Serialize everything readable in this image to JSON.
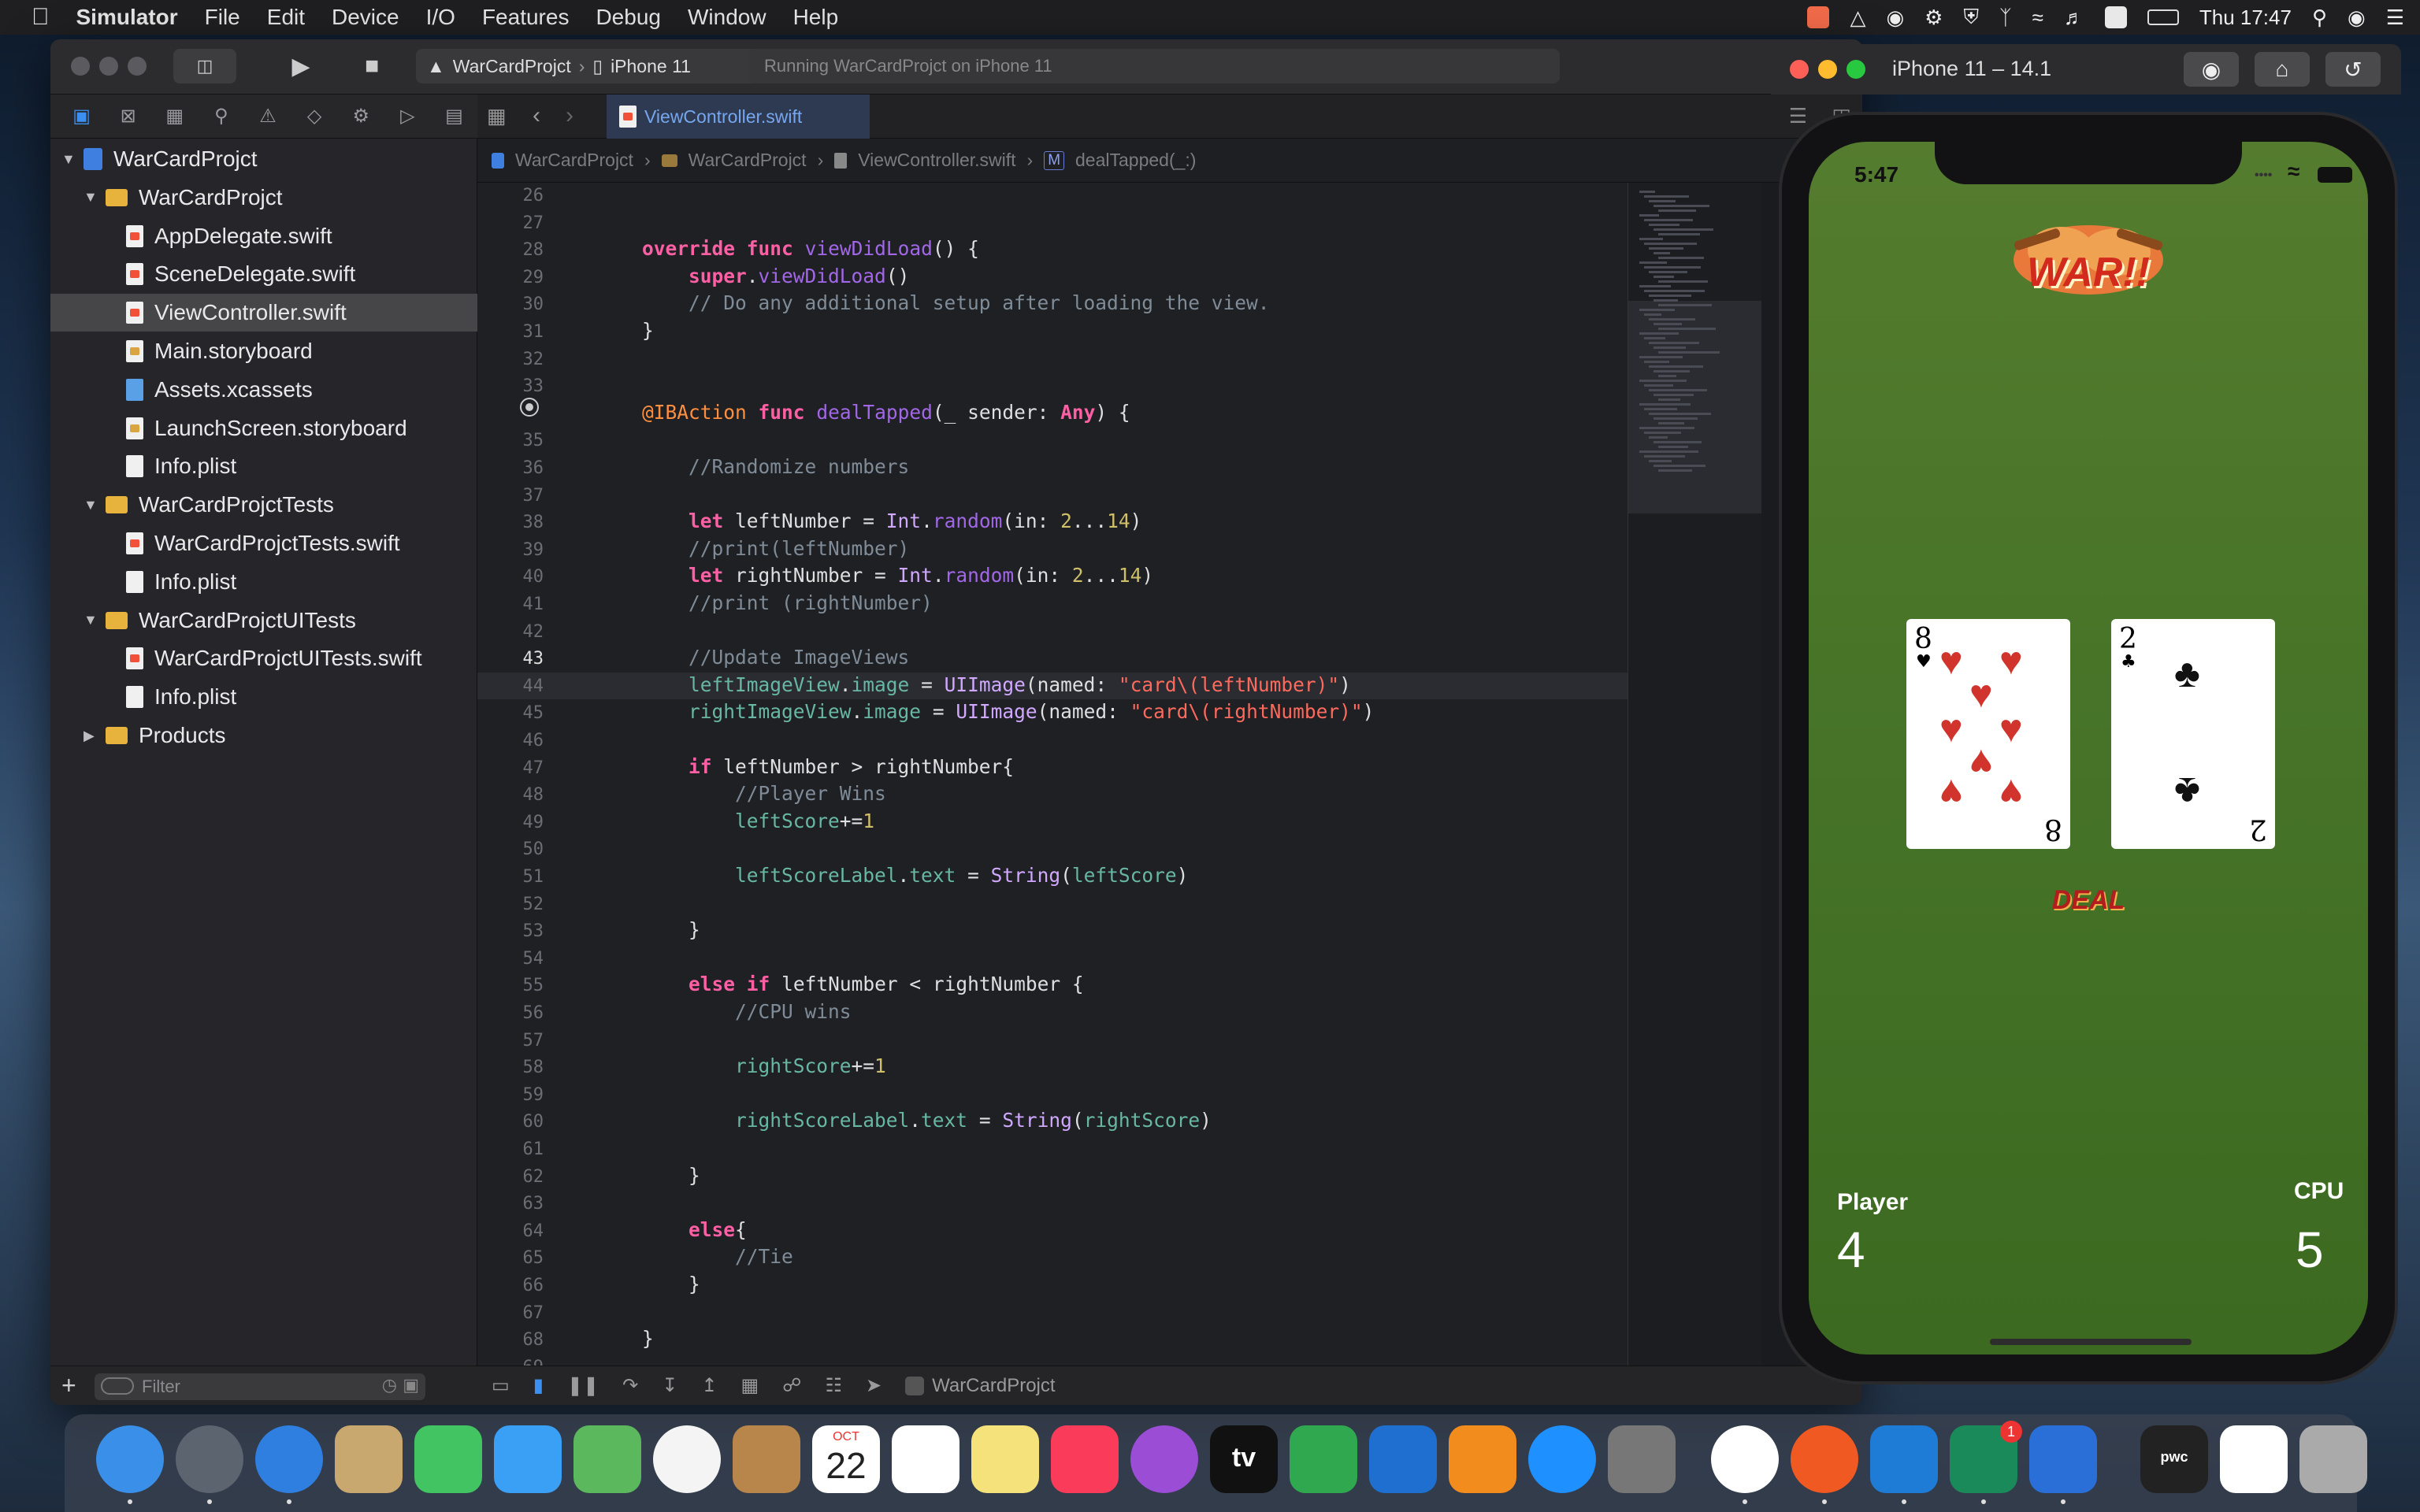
{
  "menubar": {
    "app": "Simulator",
    "items": [
      "File",
      "Edit",
      "Device",
      "I/O",
      "Features",
      "Debug",
      "Window",
      "Help"
    ],
    "clock": "Thu 17:47"
  },
  "toolbar": {
    "scheme": "WarCardProjct",
    "device": "iPhone 11",
    "status": "Running WarCardProjct on iPhone 11"
  },
  "tab": {
    "label": "ViewController.swift"
  },
  "jumpbar": {
    "path": [
      "WarCardProjct",
      "WarCardProjct",
      "ViewController.swift"
    ],
    "method_badge": "M",
    "method": "dealTapped(_:)"
  },
  "navigator": {
    "filter_placeholder": "Filter",
    "rows": [
      {
        "label": "WarCardProjct",
        "kind": "project",
        "indent": 0,
        "disclosure": "open"
      },
      {
        "label": "WarCardProjct",
        "kind": "folder",
        "indent": 1,
        "disclosure": "open"
      },
      {
        "label": "AppDelegate.swift",
        "kind": "swift",
        "indent": 2
      },
      {
        "label": "SceneDelegate.swift",
        "kind": "swift",
        "indent": 2
      },
      {
        "label": "ViewController.swift",
        "kind": "swift",
        "indent": 2,
        "selected": true
      },
      {
        "label": "Main.storyboard",
        "kind": "storyboard",
        "indent": 2
      },
      {
        "label": "Assets.xcassets",
        "kind": "assets",
        "indent": 2
      },
      {
        "label": "LaunchScreen.storyboard",
        "kind": "storyboard",
        "indent": 2
      },
      {
        "label": "Info.plist",
        "kind": "plist",
        "indent": 2
      },
      {
        "label": "WarCardProjctTests",
        "kind": "folder",
        "indent": 1,
        "disclosure": "open"
      },
      {
        "label": "WarCardProjctTests.swift",
        "kind": "swift",
        "indent": 2
      },
      {
        "label": "Info.plist",
        "kind": "plist",
        "indent": 2
      },
      {
        "label": "WarCardProjctUITests",
        "kind": "folder",
        "indent": 1,
        "disclosure": "open"
      },
      {
        "label": "WarCardProjctUITests.swift",
        "kind": "swift",
        "indent": 2
      },
      {
        "label": "Info.plist",
        "kind": "plist",
        "indent": 2
      },
      {
        "label": "Products",
        "kind": "folder",
        "indent": 1,
        "disclosure": "closed"
      }
    ]
  },
  "editor": {
    "current_line": 43,
    "lines": [
      {
        "n": "26",
        "t": ""
      },
      {
        "n": "27",
        "t": ""
      },
      {
        "n": "28",
        "t": "    override func viewDidLoad() {"
      },
      {
        "n": "29",
        "t": "        super.viewDidLoad()"
      },
      {
        "n": "30",
        "t": "        // Do any additional setup after loading the view."
      },
      {
        "n": "31",
        "t": "    }"
      },
      {
        "n": "32",
        "t": ""
      },
      {
        "n": "33",
        "t": ""
      },
      {
        "n": "",
        "t": "    @IBAction func dealTapped(_ sender: Any) {"
      },
      {
        "n": "35",
        "t": ""
      },
      {
        "n": "36",
        "t": "        //Randomize numbers"
      },
      {
        "n": "37",
        "t": ""
      },
      {
        "n": "38",
        "t": "        let leftNumber = Int.random(in: 2...14)"
      },
      {
        "n": "39",
        "t": "        //print(leftNumber)"
      },
      {
        "n": "40",
        "t": "        let rightNumber = Int.random(in: 2...14)"
      },
      {
        "n": "41",
        "t": "        //print (rightNumber)"
      },
      {
        "n": "42",
        "t": ""
      },
      {
        "n": "43",
        "t": "        //Update ImageViews"
      },
      {
        "n": "44",
        "t": "        leftImageView.image = UIImage(named: \"card\\(leftNumber)\")"
      },
      {
        "n": "45",
        "t": "        rightImageView.image = UIImage(named: \"card\\(rightNumber)\")"
      },
      {
        "n": "46",
        "t": ""
      },
      {
        "n": "47",
        "t": "        if leftNumber > rightNumber{"
      },
      {
        "n": "48",
        "t": "            //Player Wins"
      },
      {
        "n": "49",
        "t": "            leftScore+=1"
      },
      {
        "n": "50",
        "t": ""
      },
      {
        "n": "51",
        "t": "            leftScoreLabel.text = String(leftScore)"
      },
      {
        "n": "52",
        "t": ""
      },
      {
        "n": "53",
        "t": "        }"
      },
      {
        "n": "54",
        "t": ""
      },
      {
        "n": "55",
        "t": "        else if leftNumber < rightNumber {"
      },
      {
        "n": "56",
        "t": "            //CPU wins"
      },
      {
        "n": "57",
        "t": ""
      },
      {
        "n": "58",
        "t": "            rightScore+=1"
      },
      {
        "n": "59",
        "t": ""
      },
      {
        "n": "60",
        "t": "            rightScoreLabel.text = String(rightScore)"
      },
      {
        "n": "61",
        "t": ""
      },
      {
        "n": "62",
        "t": "        }"
      },
      {
        "n": "63",
        "t": ""
      },
      {
        "n": "64",
        "t": "        else{"
      },
      {
        "n": "65",
        "t": "            //Tie"
      },
      {
        "n": "66",
        "t": "        }"
      },
      {
        "n": "67",
        "t": ""
      },
      {
        "n": "68",
        "t": "    }"
      },
      {
        "n": "69",
        "t": ""
      }
    ]
  },
  "debugbar": {
    "target": "WarCardProjct"
  },
  "simulator": {
    "title": "iPhone 11 – 14.1",
    "time": "5:47",
    "left_card": {
      "rank": "8",
      "suit": "♥",
      "color": "#d0342c"
    },
    "right_card": {
      "rank": "2",
      "suit": "♣",
      "color": "#111111"
    },
    "logo_text": "WAR!!",
    "deal_label": "DEAL",
    "player_label": "Player",
    "player_score": "4",
    "cpu_label": "CPU",
    "cpu_score": "5"
  },
  "dock": {
    "apps": [
      "finder-icon",
      "launchpad-icon",
      "safari-icon",
      "mail-icon",
      "facetime-icon",
      "messages-icon",
      "maps-icon",
      "photos-icon",
      "contacts-icon",
      "calendar-icon",
      "reminders-icon",
      "notes-icon",
      "music-icon",
      "podcasts-icon",
      "tv-icon",
      "numbers-icon",
      "keynote-icon",
      "pages-icon",
      "app-store-icon",
      "system-preferences-icon",
      "chrome-icon",
      "brave-icon",
      "xcode-icon",
      "mail-client-icon",
      "simulator-icon",
      "folder-icon",
      "document-icon",
      "trash-icon"
    ],
    "calendar_month": "OCT",
    "calendar_day": "22",
    "tv_label": "tv",
    "notification_badge": "1",
    "tile_label": "pwc"
  }
}
